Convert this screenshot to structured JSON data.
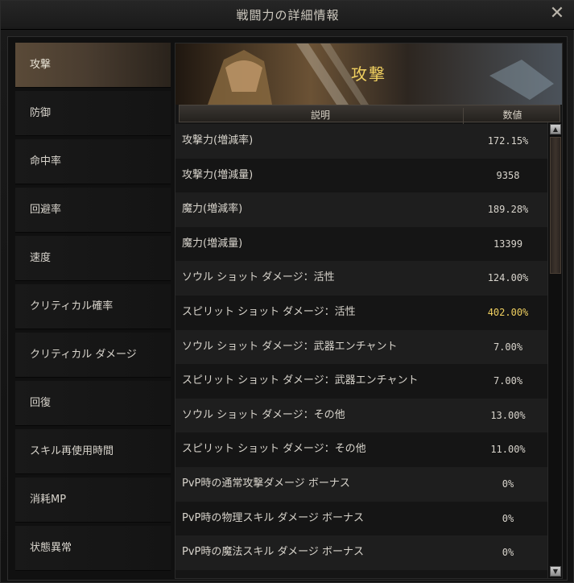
{
  "window": {
    "title": "戦闘力の詳細情報",
    "close_symbol": "✕"
  },
  "sidebar": {
    "items": [
      {
        "label": "攻撃",
        "active": true
      },
      {
        "label": "防御",
        "active": false
      },
      {
        "label": "命中率",
        "active": false
      },
      {
        "label": "回避率",
        "active": false
      },
      {
        "label": "速度",
        "active": false
      },
      {
        "label": "クリティカル確率",
        "active": false
      },
      {
        "label": "クリティカル ダメージ",
        "active": false
      },
      {
        "label": "回復",
        "active": false
      },
      {
        "label": "スキル再使用時間",
        "active": false
      },
      {
        "label": "消耗MP",
        "active": false
      },
      {
        "label": "状態異常",
        "active": false
      }
    ]
  },
  "panel": {
    "banner_title": "攻撃",
    "header": {
      "description": "説明",
      "value": "数値"
    },
    "rows": [
      {
        "label": "攻撃力(増減率)",
        "value": "172.15%"
      },
      {
        "label": "攻撃力(増減量)",
        "value": "9358"
      },
      {
        "label": "魔力(増減率)",
        "value": "189.28%"
      },
      {
        "label": "魔力(増減量)",
        "value": "13399"
      },
      {
        "label": "ソウル ショット ダメージ：活性",
        "value": "124.00%"
      },
      {
        "label": "スピリット ショット ダメージ：活性",
        "value": "402.00%"
      },
      {
        "label": "ソウル ショット ダメージ：武器エンチャント",
        "value": "7.00%"
      },
      {
        "label": "スピリット ショット ダメージ：武器エンチャント",
        "value": "7.00%"
      },
      {
        "label": "ソウル ショット ダメージ：その他",
        "value": "13.00%"
      },
      {
        "label": "スピリット ショット ダメージ：その他",
        "value": "11.00%"
      },
      {
        "label": "PvP時の通常攻撃ダメージ ボーナス",
        "value": "0%"
      },
      {
        "label": "PvP時の物理スキル ダメージ ボーナス",
        "value": "0%"
      },
      {
        "label": "PvP時の魔法スキル ダメージ ボーナス",
        "value": "0%"
      }
    ]
  },
  "colors": {
    "accent_gold": "#f0d060",
    "active_tab": "#5a4a38"
  },
  "icons": {
    "scroll_up": "▲",
    "scroll_down": "▼"
  }
}
